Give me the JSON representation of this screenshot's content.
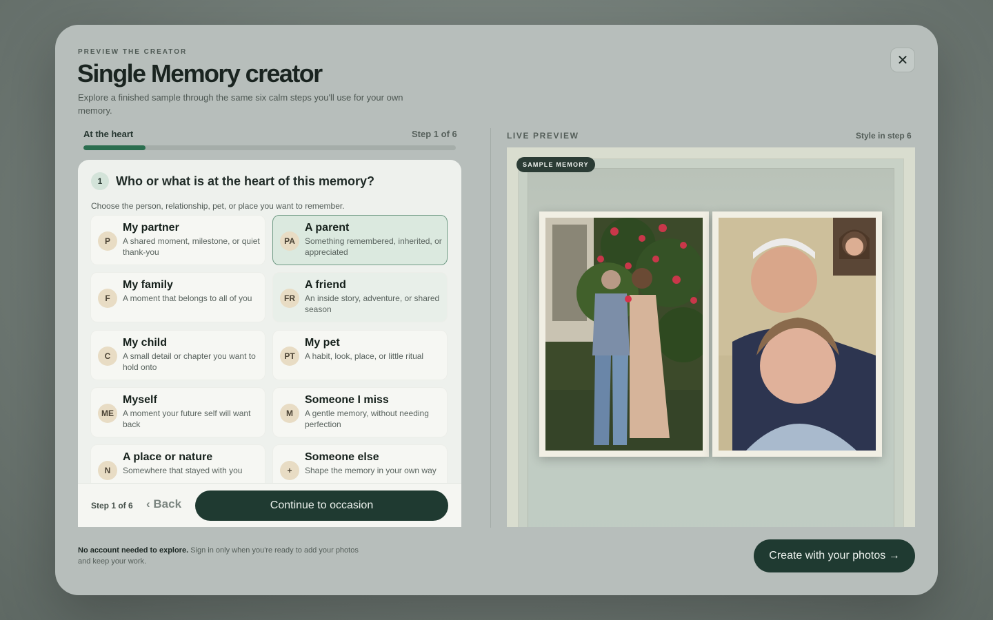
{
  "header": {
    "eyebrow": "PREVIEW THE CREATOR",
    "title": "Single Memory creator",
    "subtitle": "Explore a finished sample through the same six calm steps you'll use for your own memory.",
    "close_icon": "close-icon"
  },
  "progress": {
    "step_name": "At the heart",
    "step_count": "Step 1 of 6",
    "fraction": 0.1667
  },
  "question": {
    "number": "1",
    "text": "Who or what is at the heart of this memory?",
    "hint": "Choose the person, relationship, pet, or place you want to remember."
  },
  "options": [
    {
      "badge": "P",
      "title": "My partner",
      "desc": "A shared moment, milestone, or quiet thank-you"
    },
    {
      "badge": "PA",
      "title": "A parent",
      "desc": "Something remembered, inherited, or appreciated"
    },
    {
      "badge": "F",
      "title": "My family",
      "desc": "A moment that belongs to all of you"
    },
    {
      "badge": "FR",
      "title": "A friend",
      "desc": "An inside story, adventure, or shared season"
    },
    {
      "badge": "C",
      "title": "My child",
      "desc": "A small detail or chapter you want to hold onto"
    },
    {
      "badge": "PT",
      "title": "My pet",
      "desc": "A habit, look, place, or little ritual"
    },
    {
      "badge": "ME",
      "title": "Myself",
      "desc": "A moment your future self will want back"
    },
    {
      "badge": "M",
      "title": "Someone I miss",
      "desc": "A gentle memory, without needing perfection"
    },
    {
      "badge": "N",
      "title": "A place or nature",
      "desc": "Somewhere that stayed with you"
    },
    {
      "badge": "+",
      "title": "Someone else",
      "desc": "Shape the memory in your own way"
    }
  ],
  "footer": {
    "step": "Step 1 of 6",
    "back": "Back",
    "continue": "Continue to occasion"
  },
  "preview": {
    "label": "LIVE PREVIEW",
    "style_note": "Style in step 6",
    "sample_badge": "SAMPLE MEMORY"
  },
  "bottom": {
    "note_bold": "No account needed to explore.",
    "note_rest": " Sign in only when you're ready to add your photos and keep your work.",
    "create_button": "Create with your photos →"
  },
  "colors": {
    "accent": "#1f3a31",
    "progress": "#2b6e4f",
    "selected_bg": "#dbe9df"
  }
}
